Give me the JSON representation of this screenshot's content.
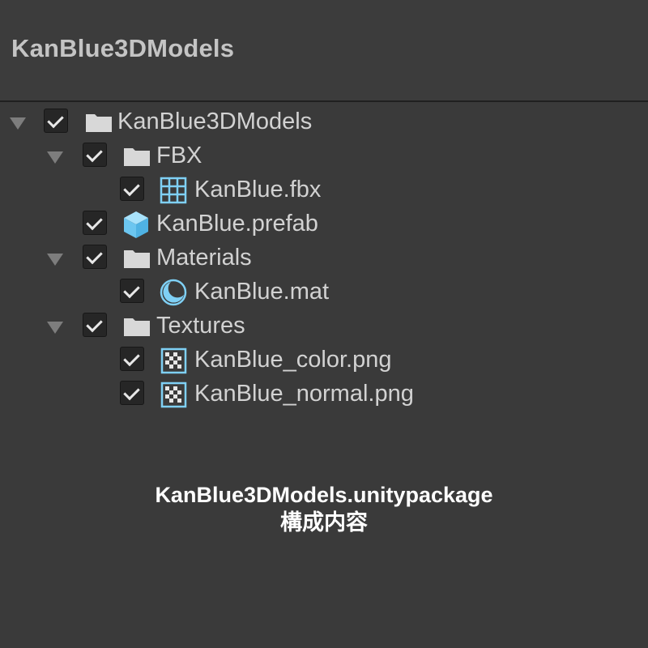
{
  "window": {
    "title": "KanBlue3DModels"
  },
  "tree": {
    "items": [
      {
        "label": "KanBlue3DModels",
        "icon": "folder-icon",
        "checked": true,
        "expanded": true
      },
      {
        "label": "FBX",
        "icon": "folder-icon",
        "checked": true,
        "expanded": true
      },
      {
        "label": "KanBlue.fbx",
        "icon": "mesh-grid-icon",
        "checked": true
      },
      {
        "label": "KanBlue.prefab",
        "icon": "prefab-cube-icon",
        "checked": true
      },
      {
        "label": "Materials",
        "icon": "folder-icon",
        "checked": true,
        "expanded": true
      },
      {
        "label": "KanBlue.mat",
        "icon": "material-sphere-icon",
        "checked": true
      },
      {
        "label": "Textures",
        "icon": "folder-icon",
        "checked": true,
        "expanded": true
      },
      {
        "label": "KanBlue_color.png",
        "icon": "texture-checker-icon",
        "checked": true
      },
      {
        "label": "KanBlue_normal.png",
        "icon": "texture-checker-icon",
        "checked": true
      }
    ]
  },
  "caption": {
    "line1": "KanBlue3DModels.unitypackage",
    "line2": "構成内容"
  },
  "colors": {
    "background": "#3a3a3a",
    "header": "#3c3c3c",
    "accent_icon": "#7fd0f5",
    "folder_icon": "#d8d8d8",
    "text": "#d2d2d2"
  }
}
